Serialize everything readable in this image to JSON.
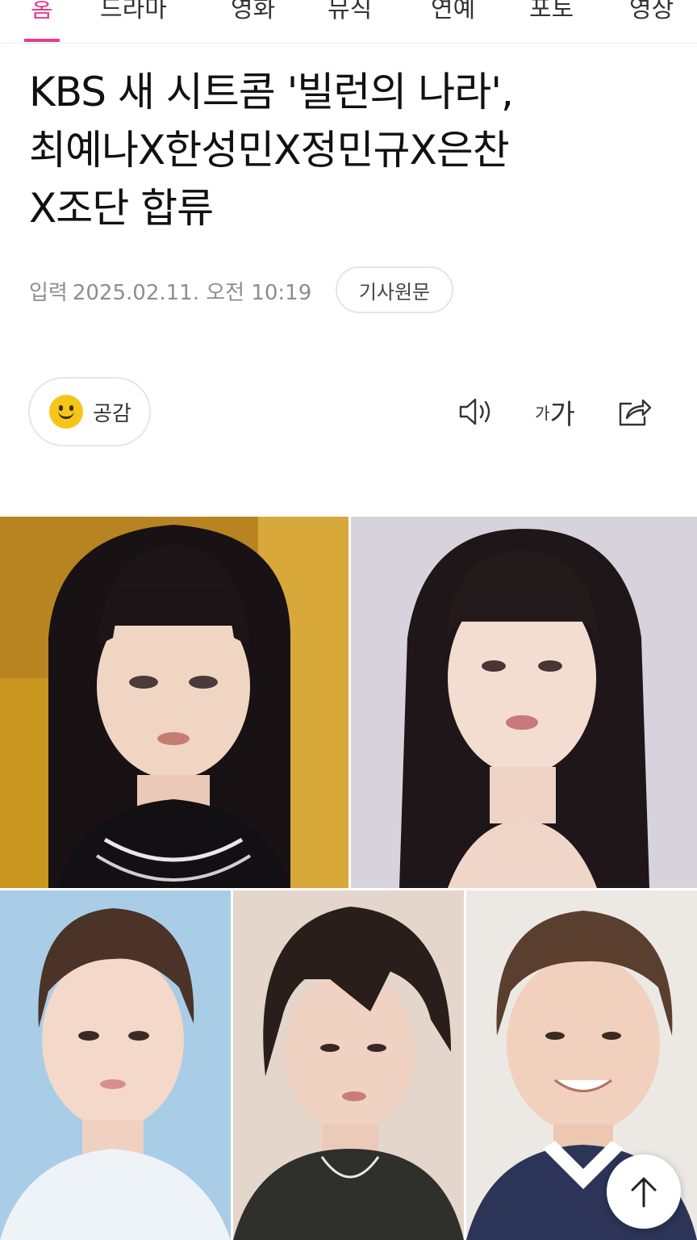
{
  "nav": {
    "tabs": [
      {
        "label": "홈",
        "active": true
      },
      {
        "label": "드라마",
        "active": false
      },
      {
        "label": "영화",
        "active": false
      },
      {
        "label": "뮤직",
        "active": false
      },
      {
        "label": "연예",
        "active": false
      },
      {
        "label": "포토",
        "active": false
      },
      {
        "label": "영상",
        "active": false
      }
    ],
    "accent_color": "#e83d8c"
  },
  "article": {
    "headline_lines": [
      "KBS 새 시트콤 '빌런의 나라',",
      "최예나X한성민X정민규X은찬",
      "X조단 합류"
    ],
    "date_prefix": "입력",
    "date": "2025.02.11. 오전 10:19",
    "source_button": "기사원문"
  },
  "actions": {
    "empathy_label": "공감",
    "empathy_icon": "smile-emoji-icon",
    "listen_icon": "speaker-icon",
    "font_size_small": "가",
    "font_size_big": "가",
    "share_icon": "share-icon"
  },
  "photos": [
    {
      "name": "photo-1"
    },
    {
      "name": "photo-2"
    },
    {
      "name": "photo-3"
    },
    {
      "name": "photo-4"
    },
    {
      "name": "photo-5"
    }
  ],
  "scroll_top_icon": "arrow-up-icon"
}
